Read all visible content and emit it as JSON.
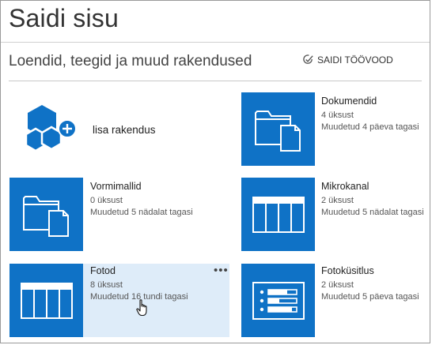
{
  "page": {
    "title": "Saidi sisu",
    "section_heading": "Loendid, teegid ja muud rakendused",
    "workflows_label": "SAIDI TÖÖVOOD"
  },
  "add_app": {
    "label": "lisa rakendus"
  },
  "apps": [
    {
      "name": "Dokumendid",
      "count": "4 üksust",
      "modified": "Muudetud 4 päeva tagasi",
      "icon": "document-library-icon"
    },
    {
      "name": "Vormimallid",
      "count": "0 üksust",
      "modified": "Muudetud 5 nädalat tagasi",
      "icon": "form-templates-icon"
    },
    {
      "name": "Mikrokanal",
      "count": "2 üksust",
      "modified": "Muudetud 5 nädalat tagasi",
      "icon": "list-icon"
    },
    {
      "name": "Fotod",
      "count": "8 üksust",
      "modified": "Muudetud 16 tundi tagasi",
      "icon": "list-icon"
    },
    {
      "name": "Fotoküsitlus",
      "count": "2 üksust",
      "modified": "Muudetud 5 päeva tagasi",
      "icon": "survey-icon"
    }
  ],
  "hovered_app": "Fotod",
  "more_options": "•••",
  "colors": {
    "tile": "#0f72c6",
    "hover": "#deecf9"
  }
}
